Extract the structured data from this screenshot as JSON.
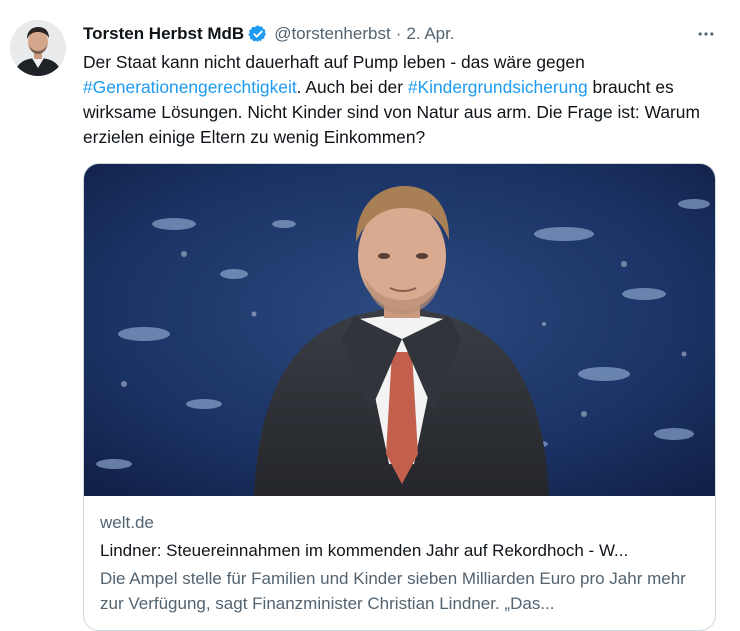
{
  "tweet": {
    "author_name": "Torsten Herbst MdB",
    "handle": "@torstenherbst",
    "separator": "·",
    "date": "2. Apr.",
    "more_icon": "more-horizontal-icon",
    "verified_icon": "verified-badge-icon",
    "text": {
      "part1": "Der Staat kann nicht dauerhaft auf Pump leben - das wäre gegen ",
      "hashtag1": "#Generationengerechtigkeit",
      "part2": ". Auch bei der ",
      "hashtag2": "#Kindergrundsicherung",
      "part3": " braucht es wirksame Lösungen. Nicht Kinder sind von Natur aus arm. Die Frage ist: Warum erzielen einige Eltern zu wenig Einkommen?"
    }
  },
  "card": {
    "domain": "welt.de",
    "title": "Lindner: Steuereinnahmen im kommenden Jahr auf Rekordhoch - W...",
    "description": "Die Ampel stelle für Familien und Kinder sieben Milliarden Euro pro Jahr mehr zur Verfügung, sagt Finanzminister Christian Lindner. „Das..."
  },
  "colors": {
    "text": "#0f1419",
    "secondary": "#536471",
    "link": "#1d9bf0",
    "verified": "#1d9bf0",
    "border": "#cfd9de"
  }
}
